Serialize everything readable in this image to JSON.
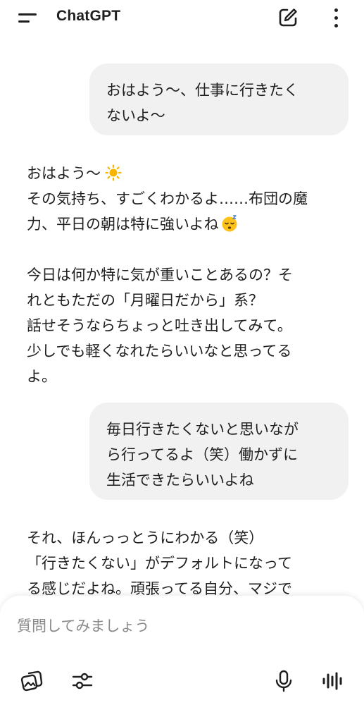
{
  "header": {
    "title": "ChatGPT"
  },
  "messages": {
    "user_1": "おはよう〜、仕事に行きたく\nないよ〜",
    "assistant_1": {
      "line_1": "おはよう〜",
      "text_a": "その気持ち、すごくわかるよ……布団の魔\n力、平日の朝は特に強いよね",
      "text_b": "今日は何か特に気が重いことあるの？そ\nれともただの「月曜日だから」系？\n話せそうならちょっと吐き出してみて。\n少しでも軽くなれたらいいなと思ってる\nよ。"
    },
    "user_2": "毎日行きたくないと思いなが\nら行ってるよ（笑）働かずに\n生活できたらいいよね",
    "assistant_2": "それ、ほんっっとうにわかる（笑）\n「行きたくない」がデフォルトになって\nる感じだよね。頑張ってる自分、マジで"
  },
  "composer": {
    "placeholder": "質問してみましょう"
  },
  "icons": {
    "menu": "menu-icon",
    "new_chat": "new-chat-icon",
    "more": "more-vertical-icon",
    "attach": "image-attach-icon",
    "settings": "sliders-icon",
    "mic": "microphone-icon",
    "voice": "voice-mode-icon",
    "sun": "sun-emoji",
    "sleepy": "sleepy-face-emoji"
  }
}
